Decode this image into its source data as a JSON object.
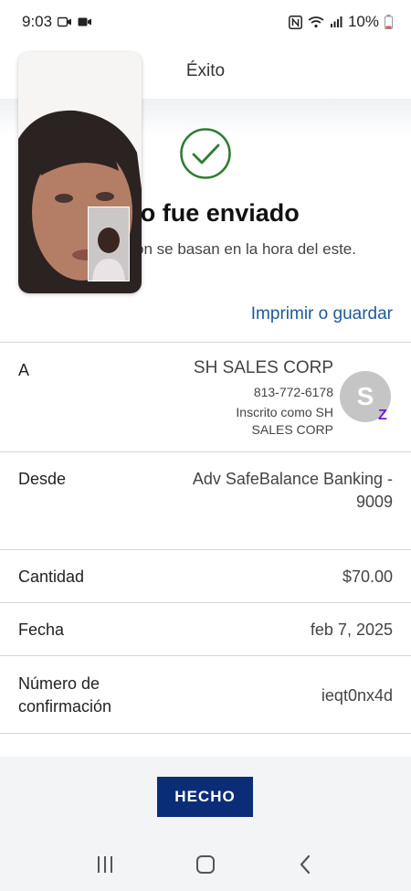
{
  "status_bar": {
    "time": "9:03",
    "battery": "10%"
  },
  "header": {
    "title": "Éxito"
  },
  "confirmation": {
    "title": "ago fue enviado",
    "note": "transacción se basan en la hora del este.",
    "print_link": "Imprimir o guardar"
  },
  "details": {
    "to_label": "A",
    "payee_name": "SH SALES CORP",
    "payee_phone": "813-772-6178",
    "payee_enrolled": "Inscrito como SH SALES CORP",
    "avatar_letter": "S",
    "zelle_mark": "Z",
    "from_label": "Desde",
    "from_value": "Adv SafeBalance Banking - 9009",
    "amount_label": "Cantidad",
    "amount_value": "$70.00",
    "date_label": "Fecha",
    "date_value": "feb 7, 2025",
    "confirmation_label": "Número de confirmación",
    "confirmation_value": "ieqt0nx4d"
  },
  "footer": {
    "done_label": "HECHO"
  },
  "colors": {
    "accent": "#1d5a9a",
    "button": "#0b2d78",
    "success": "#2e7d32",
    "zelle": "#6d1ed4"
  }
}
